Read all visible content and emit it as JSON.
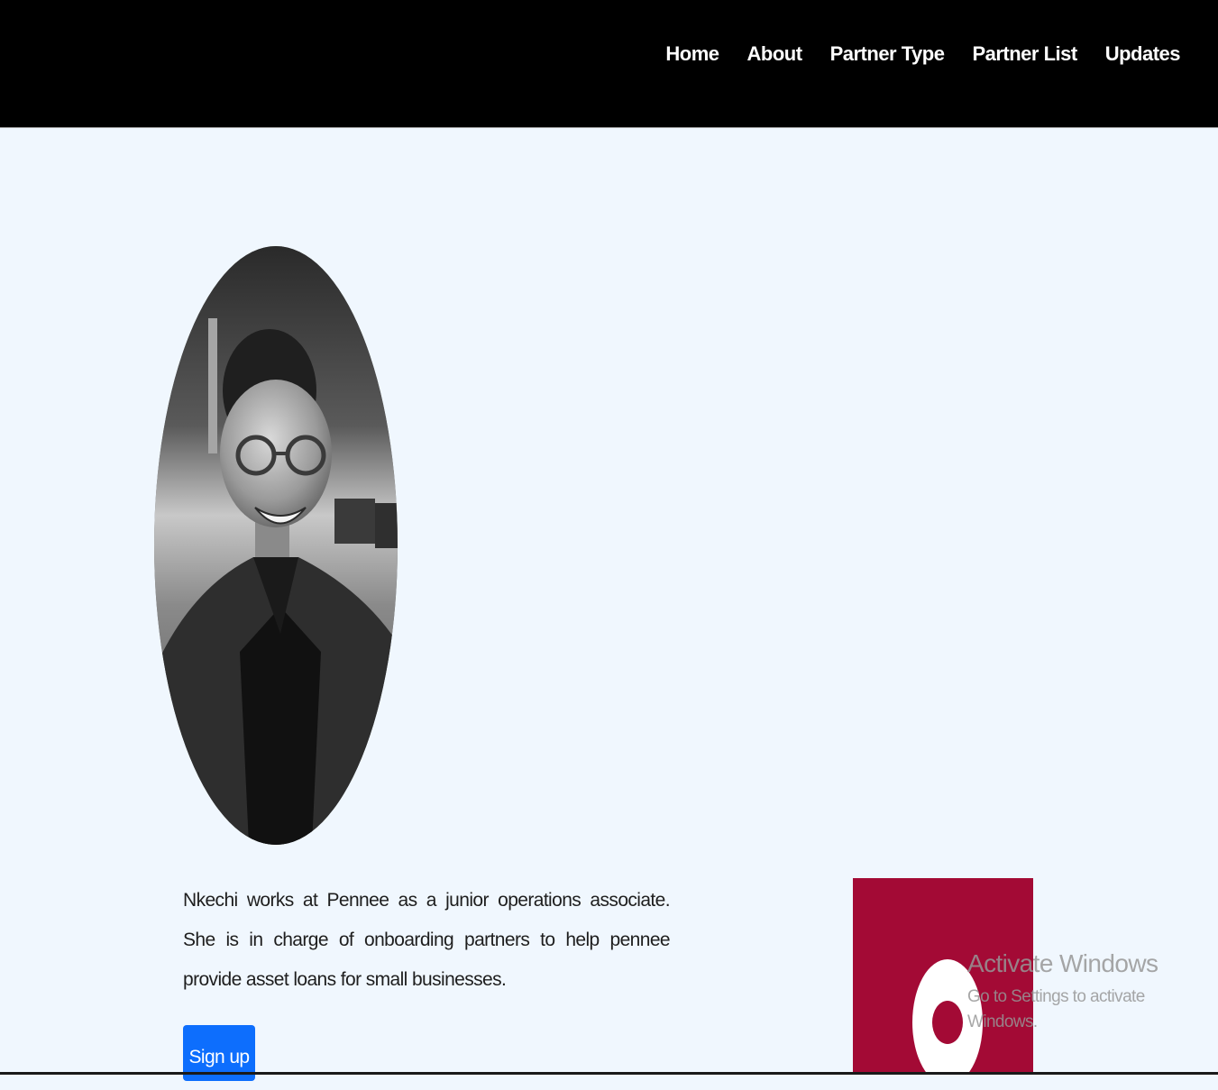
{
  "nav": {
    "items": [
      {
        "label": "Home"
      },
      {
        "label": "About"
      },
      {
        "label": "Partner Type"
      },
      {
        "label": "Partner List"
      },
      {
        "label": "Updates"
      }
    ]
  },
  "profile": {
    "bio": "Nkechi works at Pennee as a junior operations associate. She is in charge of onboarding partners to help pennee provide asset loans for small businesses.",
    "signup_label": "Sign up"
  },
  "watermark": {
    "title": "Activate Windows",
    "subtitle": "Go to Settings to activate Windows."
  },
  "colors": {
    "header_bg": "#000000",
    "page_bg": "#f0f7fe",
    "button": "#0d6efd",
    "promo_card": "#a30a35"
  }
}
